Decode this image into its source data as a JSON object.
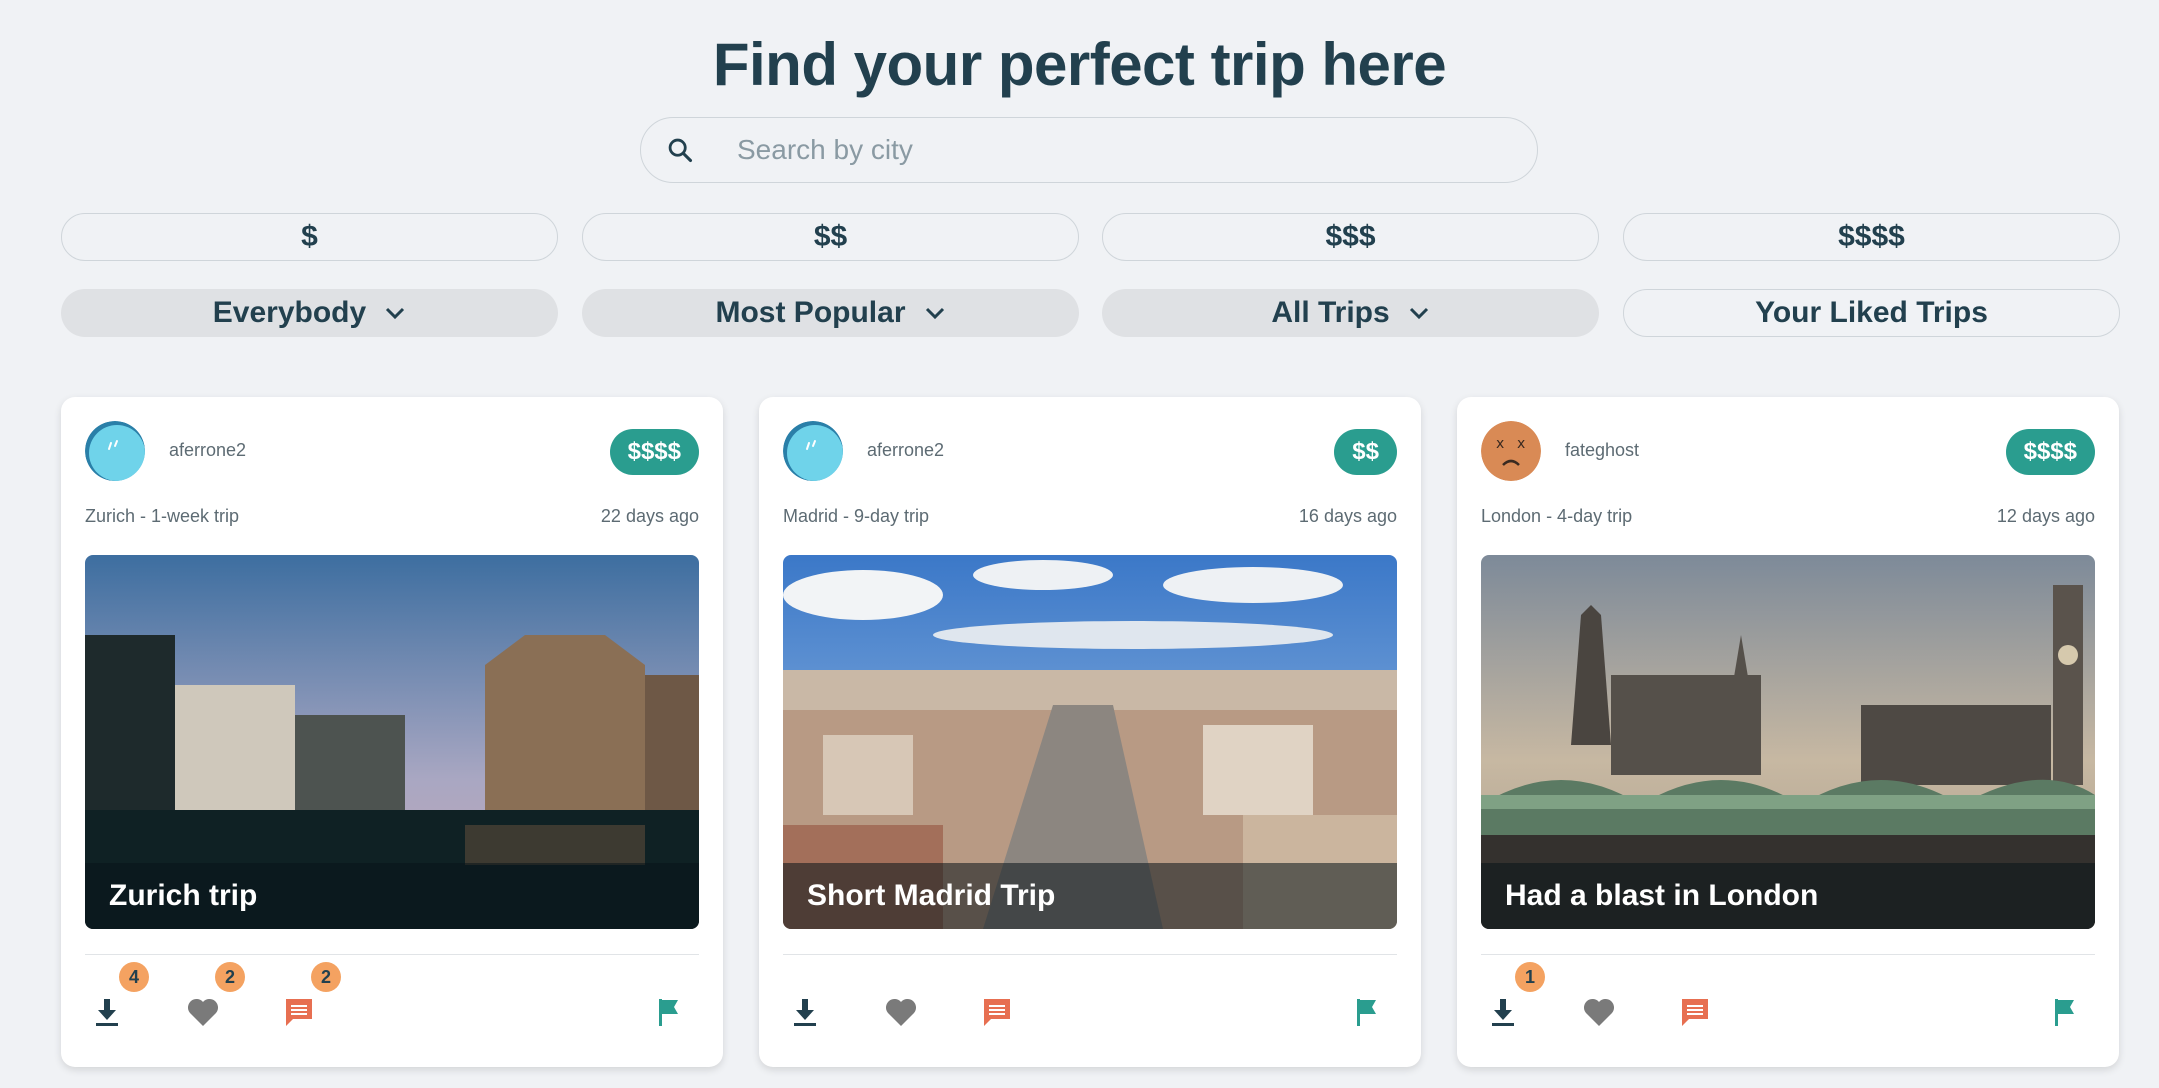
{
  "header": {
    "title": "Find your perfect trip here"
  },
  "search": {
    "placeholder": "Search by city",
    "icon": "search-icon"
  },
  "price_filters": [
    "$",
    "$$",
    "$$$",
    "$$$$"
  ],
  "dropdown_filters": {
    "audience": "Everybody",
    "sort": "Most Popular",
    "scope": "All Trips",
    "liked": "Your Liked Trips"
  },
  "colors": {
    "accent": "#2a9d8f",
    "badge": "#f4a261",
    "comment": "#e76f51",
    "text": "#22404e",
    "background": "#f0f2f5"
  },
  "trips": [
    {
      "username": "aferrone2",
      "price": "$$$$",
      "location": "Zurich - 1-week trip",
      "age": "22 days ago",
      "caption": "Zurich trip",
      "downloads": "4",
      "likes": "2",
      "comments": "2"
    },
    {
      "username": "aferrone2",
      "price": "$$",
      "location": "Madrid - 9-day trip",
      "age": "16 days ago",
      "caption": "Short Madrid Trip"
    },
    {
      "username": "fateghost",
      "price": "$$$$",
      "location": "London - 4-day trip",
      "age": "12 days ago",
      "caption": "Had a blast in London",
      "downloads": "1"
    }
  ]
}
